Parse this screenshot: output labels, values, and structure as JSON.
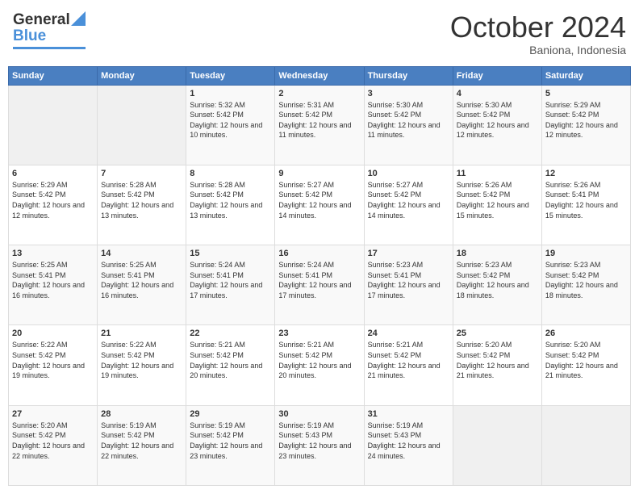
{
  "header": {
    "logo_general": "General",
    "logo_blue": "Blue",
    "month": "October 2024",
    "location": "Baniona, Indonesia"
  },
  "weekdays": [
    "Sunday",
    "Monday",
    "Tuesday",
    "Wednesday",
    "Thursday",
    "Friday",
    "Saturday"
  ],
  "weeks": [
    [
      {
        "day": "",
        "sunrise": "",
        "sunset": "",
        "daylight": ""
      },
      {
        "day": "",
        "sunrise": "",
        "sunset": "",
        "daylight": ""
      },
      {
        "day": "1",
        "sunrise": "Sunrise: 5:32 AM",
        "sunset": "Sunset: 5:42 PM",
        "daylight": "Daylight: 12 hours and 10 minutes."
      },
      {
        "day": "2",
        "sunrise": "Sunrise: 5:31 AM",
        "sunset": "Sunset: 5:42 PM",
        "daylight": "Daylight: 12 hours and 11 minutes."
      },
      {
        "day": "3",
        "sunrise": "Sunrise: 5:30 AM",
        "sunset": "Sunset: 5:42 PM",
        "daylight": "Daylight: 12 hours and 11 minutes."
      },
      {
        "day": "4",
        "sunrise": "Sunrise: 5:30 AM",
        "sunset": "Sunset: 5:42 PM",
        "daylight": "Daylight: 12 hours and 12 minutes."
      },
      {
        "day": "5",
        "sunrise": "Sunrise: 5:29 AM",
        "sunset": "Sunset: 5:42 PM",
        "daylight": "Daylight: 12 hours and 12 minutes."
      }
    ],
    [
      {
        "day": "6",
        "sunrise": "Sunrise: 5:29 AM",
        "sunset": "Sunset: 5:42 PM",
        "daylight": "Daylight: 12 hours and 12 minutes."
      },
      {
        "day": "7",
        "sunrise": "Sunrise: 5:28 AM",
        "sunset": "Sunset: 5:42 PM",
        "daylight": "Daylight: 12 hours and 13 minutes."
      },
      {
        "day": "8",
        "sunrise": "Sunrise: 5:28 AM",
        "sunset": "Sunset: 5:42 PM",
        "daylight": "Daylight: 12 hours and 13 minutes."
      },
      {
        "day": "9",
        "sunrise": "Sunrise: 5:27 AM",
        "sunset": "Sunset: 5:42 PM",
        "daylight": "Daylight: 12 hours and 14 minutes."
      },
      {
        "day": "10",
        "sunrise": "Sunrise: 5:27 AM",
        "sunset": "Sunset: 5:42 PM",
        "daylight": "Daylight: 12 hours and 14 minutes."
      },
      {
        "day": "11",
        "sunrise": "Sunrise: 5:26 AM",
        "sunset": "Sunset: 5:42 PM",
        "daylight": "Daylight: 12 hours and 15 minutes."
      },
      {
        "day": "12",
        "sunrise": "Sunrise: 5:26 AM",
        "sunset": "Sunset: 5:41 PM",
        "daylight": "Daylight: 12 hours and 15 minutes."
      }
    ],
    [
      {
        "day": "13",
        "sunrise": "Sunrise: 5:25 AM",
        "sunset": "Sunset: 5:41 PM",
        "daylight": "Daylight: 12 hours and 16 minutes."
      },
      {
        "day": "14",
        "sunrise": "Sunrise: 5:25 AM",
        "sunset": "Sunset: 5:41 PM",
        "daylight": "Daylight: 12 hours and 16 minutes."
      },
      {
        "day": "15",
        "sunrise": "Sunrise: 5:24 AM",
        "sunset": "Sunset: 5:41 PM",
        "daylight": "Daylight: 12 hours and 17 minutes."
      },
      {
        "day": "16",
        "sunrise": "Sunrise: 5:24 AM",
        "sunset": "Sunset: 5:41 PM",
        "daylight": "Daylight: 12 hours and 17 minutes."
      },
      {
        "day": "17",
        "sunrise": "Sunrise: 5:23 AM",
        "sunset": "Sunset: 5:41 PM",
        "daylight": "Daylight: 12 hours and 17 minutes."
      },
      {
        "day": "18",
        "sunrise": "Sunrise: 5:23 AM",
        "sunset": "Sunset: 5:42 PM",
        "daylight": "Daylight: 12 hours and 18 minutes."
      },
      {
        "day": "19",
        "sunrise": "Sunrise: 5:23 AM",
        "sunset": "Sunset: 5:42 PM",
        "daylight": "Daylight: 12 hours and 18 minutes."
      }
    ],
    [
      {
        "day": "20",
        "sunrise": "Sunrise: 5:22 AM",
        "sunset": "Sunset: 5:42 PM",
        "daylight": "Daylight: 12 hours and 19 minutes."
      },
      {
        "day": "21",
        "sunrise": "Sunrise: 5:22 AM",
        "sunset": "Sunset: 5:42 PM",
        "daylight": "Daylight: 12 hours and 19 minutes."
      },
      {
        "day": "22",
        "sunrise": "Sunrise: 5:21 AM",
        "sunset": "Sunset: 5:42 PM",
        "daylight": "Daylight: 12 hours and 20 minutes."
      },
      {
        "day": "23",
        "sunrise": "Sunrise: 5:21 AM",
        "sunset": "Sunset: 5:42 PM",
        "daylight": "Daylight: 12 hours and 20 minutes."
      },
      {
        "day": "24",
        "sunrise": "Sunrise: 5:21 AM",
        "sunset": "Sunset: 5:42 PM",
        "daylight": "Daylight: 12 hours and 21 minutes."
      },
      {
        "day": "25",
        "sunrise": "Sunrise: 5:20 AM",
        "sunset": "Sunset: 5:42 PM",
        "daylight": "Daylight: 12 hours and 21 minutes."
      },
      {
        "day": "26",
        "sunrise": "Sunrise: 5:20 AM",
        "sunset": "Sunset: 5:42 PM",
        "daylight": "Daylight: 12 hours and 21 minutes."
      }
    ],
    [
      {
        "day": "27",
        "sunrise": "Sunrise: 5:20 AM",
        "sunset": "Sunset: 5:42 PM",
        "daylight": "Daylight: 12 hours and 22 minutes."
      },
      {
        "day": "28",
        "sunrise": "Sunrise: 5:19 AM",
        "sunset": "Sunset: 5:42 PM",
        "daylight": "Daylight: 12 hours and 22 minutes."
      },
      {
        "day": "29",
        "sunrise": "Sunrise: 5:19 AM",
        "sunset": "Sunset: 5:42 PM",
        "daylight": "Daylight: 12 hours and 23 minutes."
      },
      {
        "day": "30",
        "sunrise": "Sunrise: 5:19 AM",
        "sunset": "Sunset: 5:43 PM",
        "daylight": "Daylight: 12 hours and 23 minutes."
      },
      {
        "day": "31",
        "sunrise": "Sunrise: 5:19 AM",
        "sunset": "Sunset: 5:43 PM",
        "daylight": "Daylight: 12 hours and 24 minutes."
      },
      {
        "day": "",
        "sunrise": "",
        "sunset": "",
        "daylight": ""
      },
      {
        "day": "",
        "sunrise": "",
        "sunset": "",
        "daylight": ""
      }
    ]
  ]
}
